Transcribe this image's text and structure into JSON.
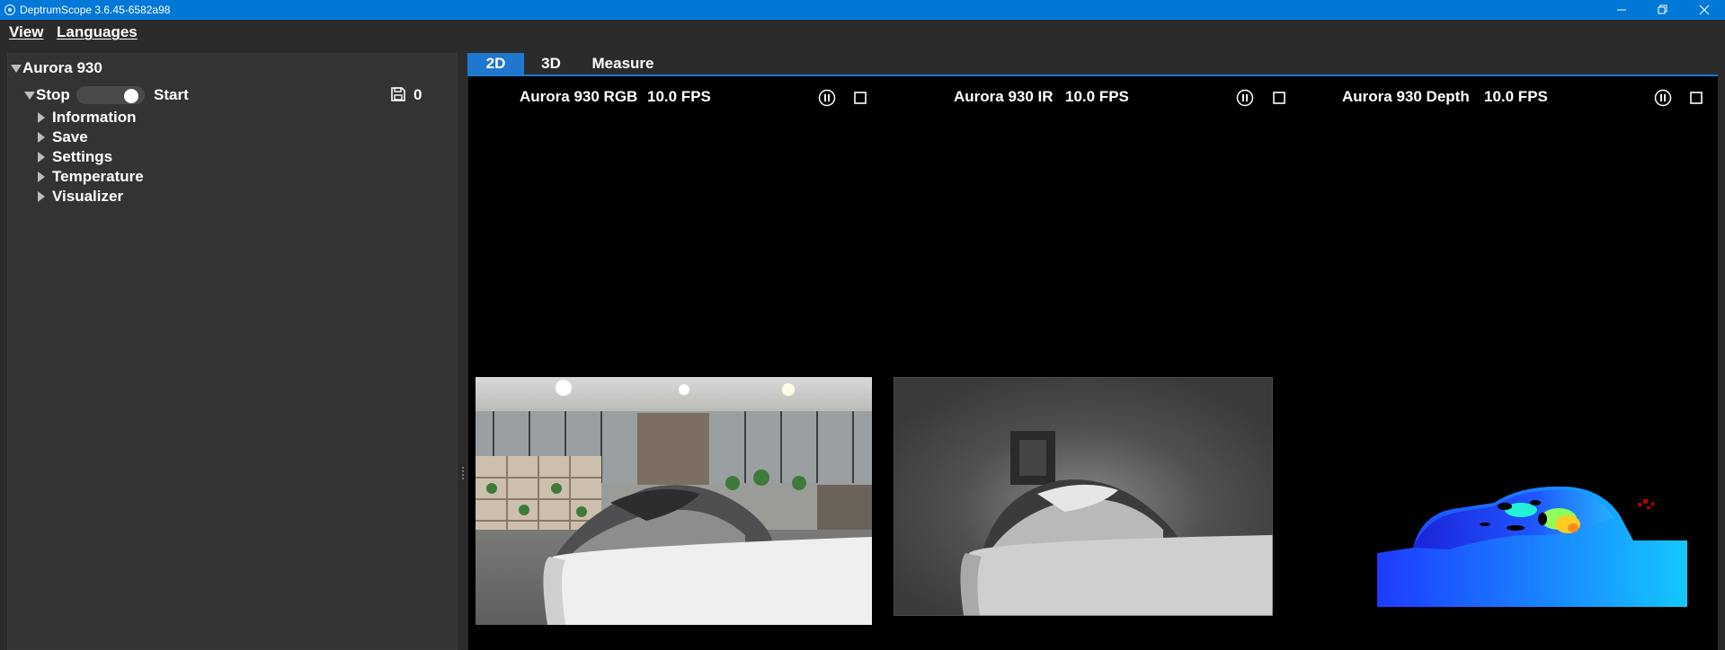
{
  "window": {
    "title": "DeptrumScope 3.6.45-6582a98",
    "accent": "#0078d7"
  },
  "menu": {
    "items": [
      {
        "label": "View"
      },
      {
        "label": "Languages"
      }
    ]
  },
  "device_panel": {
    "device_name": "Aurora 930",
    "stop_label": "Stop",
    "start_label": "Start",
    "toggle_state": "off",
    "saved_count": "0",
    "sections": [
      {
        "label": "Information"
      },
      {
        "label": "Save"
      },
      {
        "label": "Settings"
      },
      {
        "label": "Temperature"
      },
      {
        "label": "Visualizer"
      }
    ]
  },
  "tabs": {
    "items": [
      {
        "label": "2D",
        "active": true
      },
      {
        "label": "3D",
        "active": false
      },
      {
        "label": "Measure",
        "active": false
      }
    ],
    "active_color": "#1f77d0"
  },
  "streams": [
    {
      "title": "Aurora 930 RGB",
      "fps": "10.0 FPS",
      "view": "rgb-camera-image"
    },
    {
      "title": "Aurora 930 IR",
      "fps": "10.0 FPS",
      "view": "ir-camera-image"
    },
    {
      "title": "Aurora 930 Depth",
      "fps": "10.0 FPS",
      "view": "depth-colormap-image"
    }
  ],
  "icons": {
    "app": "app-logo-icon",
    "minimize": "minimize-icon",
    "maximize": "restore-icon",
    "close": "close-icon",
    "save": "save-icon",
    "pause": "pause-icon",
    "stop": "stop-icon",
    "expand": "chevron-right-icon",
    "collapse": "chevron-down-icon"
  }
}
